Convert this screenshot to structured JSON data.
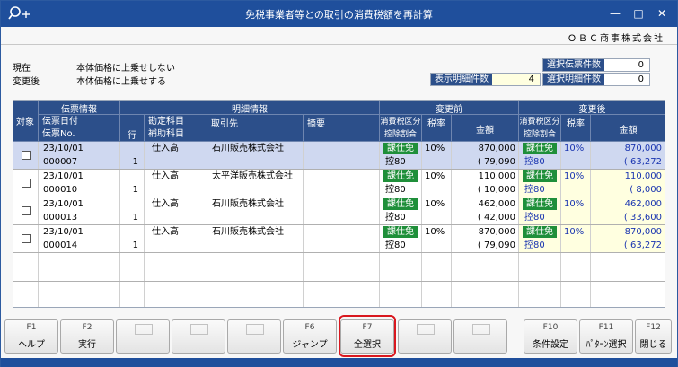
{
  "title": "免税事業者等との取引の消費税額を再計算",
  "company": "ＯＢＣ商事株式会社",
  "window_controls": {
    "minimize": "—",
    "maximize": "□",
    "close": "✕"
  },
  "info": {
    "current_label": "現在",
    "current_value": "本体価格に上乗せしない",
    "after_label": "変更後",
    "after_value": "本体価格に上乗せする"
  },
  "counts": {
    "display_label": "表示明細件数",
    "display_value": "4",
    "selected_slip_label": "選択伝票件数",
    "selected_slip_value": "0",
    "selected_detail_label": "選択明細件数",
    "selected_detail_value": "0"
  },
  "grid_headers": {
    "select": "対象",
    "slip_info": "伝票情報",
    "slip_date": "伝票日付",
    "slip_no": "伝票No.",
    "line": "行",
    "detail_info": "明細情報",
    "account": "勘定科目",
    "sub_account": "補助科目",
    "partner": "取引先",
    "summary": "摘要",
    "before": "変更前",
    "after": "変更後",
    "tax_category": "消費税区分",
    "deduction": "控除割合",
    "rate": "税率",
    "amount": "金額"
  },
  "rows": [
    {
      "date": "23/10/01",
      "no": "000007",
      "line": "1",
      "account": "仕入高",
      "partner": "石川販売株式会社",
      "b_cat": "課仕免",
      "b_ded": "控80",
      "b_rate": "10%",
      "b_amt": "870,000",
      "b_tax": "( 79,090",
      "a_cat": "課仕免",
      "a_ded": "控80",
      "a_rate": "10%",
      "a_amt": "870,000",
      "a_tax": "( 63,272"
    },
    {
      "date": "23/10/01",
      "no": "000010",
      "line": "1",
      "account": "仕入高",
      "partner": "太平洋販売株式会社",
      "b_cat": "課仕免",
      "b_ded": "控80",
      "b_rate": "10%",
      "b_amt": "110,000",
      "b_tax": "( 10,000",
      "a_cat": "課仕免",
      "a_ded": "控80",
      "a_rate": "10%",
      "a_amt": "110,000",
      "a_tax": "( 8,000"
    },
    {
      "date": "23/10/01",
      "no": "000013",
      "line": "1",
      "account": "仕入高",
      "partner": "石川販売株式会社",
      "b_cat": "課仕免",
      "b_ded": "控80",
      "b_rate": "10%",
      "b_amt": "462,000",
      "b_tax": "( 42,000",
      "a_cat": "課仕免",
      "a_ded": "控80",
      "a_rate": "10%",
      "a_amt": "462,000",
      "a_tax": "( 33,600"
    },
    {
      "date": "23/10/01",
      "no": "000014",
      "line": "1",
      "account": "仕入高",
      "partner": "石川販売株式会社",
      "b_cat": "課仕免",
      "b_ded": "控80",
      "b_rate": "10%",
      "b_amt": "870,000",
      "b_tax": "( 79,090",
      "a_cat": "課仕免",
      "a_ded": "控80",
      "a_rate": "10%",
      "a_amt": "870,000",
      "a_tax": "( 63,272"
    }
  ],
  "fkeys": [
    {
      "key": "F1",
      "label": "ヘルプ"
    },
    {
      "key": "F2",
      "label": "実行"
    },
    {
      "key": "",
      "label": ""
    },
    {
      "key": "",
      "label": ""
    },
    {
      "key": "",
      "label": ""
    },
    {
      "key": "F6",
      "label": "ジャンプ"
    },
    {
      "key": "F7",
      "label": "全選択"
    },
    {
      "key": "",
      "label": ""
    },
    {
      "key": "",
      "label": ""
    },
    {
      "key": "F10",
      "label": "条件設定"
    },
    {
      "key": "F11",
      "label": "ﾊﾟﾀｰﾝ選択"
    },
    {
      "key": "F12",
      "label": "閉じる"
    }
  ],
  "colors": {
    "titlebar": "#1f4f9c",
    "header": "#2c4f8a",
    "selected_row": "#cfd8f0",
    "badge": "#1f8f3a",
    "highlight": "#d9181f",
    "after_blue": "#1a35b0"
  }
}
